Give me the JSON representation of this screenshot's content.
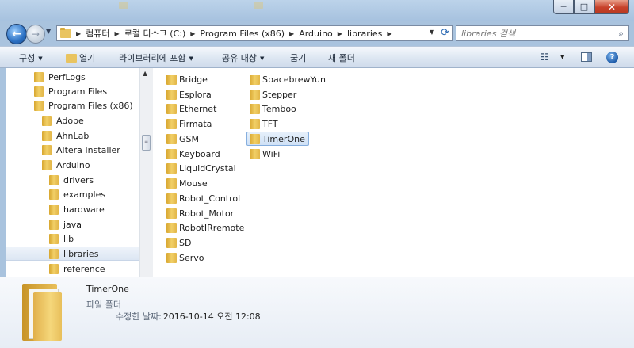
{
  "window": {
    "minimize_label": "─",
    "maximize_label": "□",
    "close_label": "✕"
  },
  "address": {
    "crumbs": [
      "컴퓨터",
      "로컬 디스크 (C:)",
      "Program Files (x86)",
      "Arduino",
      "libraries"
    ]
  },
  "search": {
    "placeholder": "libraries 검색"
  },
  "toolbar": {
    "organize": "구성",
    "open": "열기",
    "include_in_library": "라이브러리에 포함",
    "share_with": "공유 대상",
    "burn": "굽기",
    "new_folder": "새 폴더"
  },
  "nav_tree": [
    {
      "label": "PerfLogs",
      "indent": 0
    },
    {
      "label": "Program Files",
      "indent": 0
    },
    {
      "label": "Program Files (x86)",
      "indent": 0
    },
    {
      "label": "Adobe",
      "indent": 1
    },
    {
      "label": "AhnLab",
      "indent": 1
    },
    {
      "label": "Altera Installer",
      "indent": 1
    },
    {
      "label": "Arduino",
      "indent": 1
    },
    {
      "label": "drivers",
      "indent": 2
    },
    {
      "label": "examples",
      "indent": 2
    },
    {
      "label": "hardware",
      "indent": 2
    },
    {
      "label": "java",
      "indent": 2
    },
    {
      "label": "lib",
      "indent": 2
    },
    {
      "label": "libraries",
      "indent": 2,
      "selected": true
    },
    {
      "label": "reference",
      "indent": 2
    }
  ],
  "files": {
    "column1": [
      "Bridge",
      "Esplora",
      "Ethernet",
      "Firmata",
      "GSM",
      "Keyboard",
      "LiquidCrystal",
      "Mouse",
      "Robot_Control",
      "Robot_Motor",
      "RobotIRremote",
      "SD",
      "Servo"
    ],
    "column2": [
      "SpacebrewYun",
      "Stepper",
      "Temboo",
      "TFT",
      "TimerOne",
      "WiFi"
    ],
    "selected": "TimerOne"
  },
  "details": {
    "name": "TimerOne",
    "type": "파일 폴더",
    "modified_label": "수정한 날짜:",
    "modified_value": "2016-10-14 오전 12:08"
  },
  "colors": {
    "folder": "#e9c460",
    "selection_border": "#85aede",
    "frame": "#a9c3de"
  }
}
